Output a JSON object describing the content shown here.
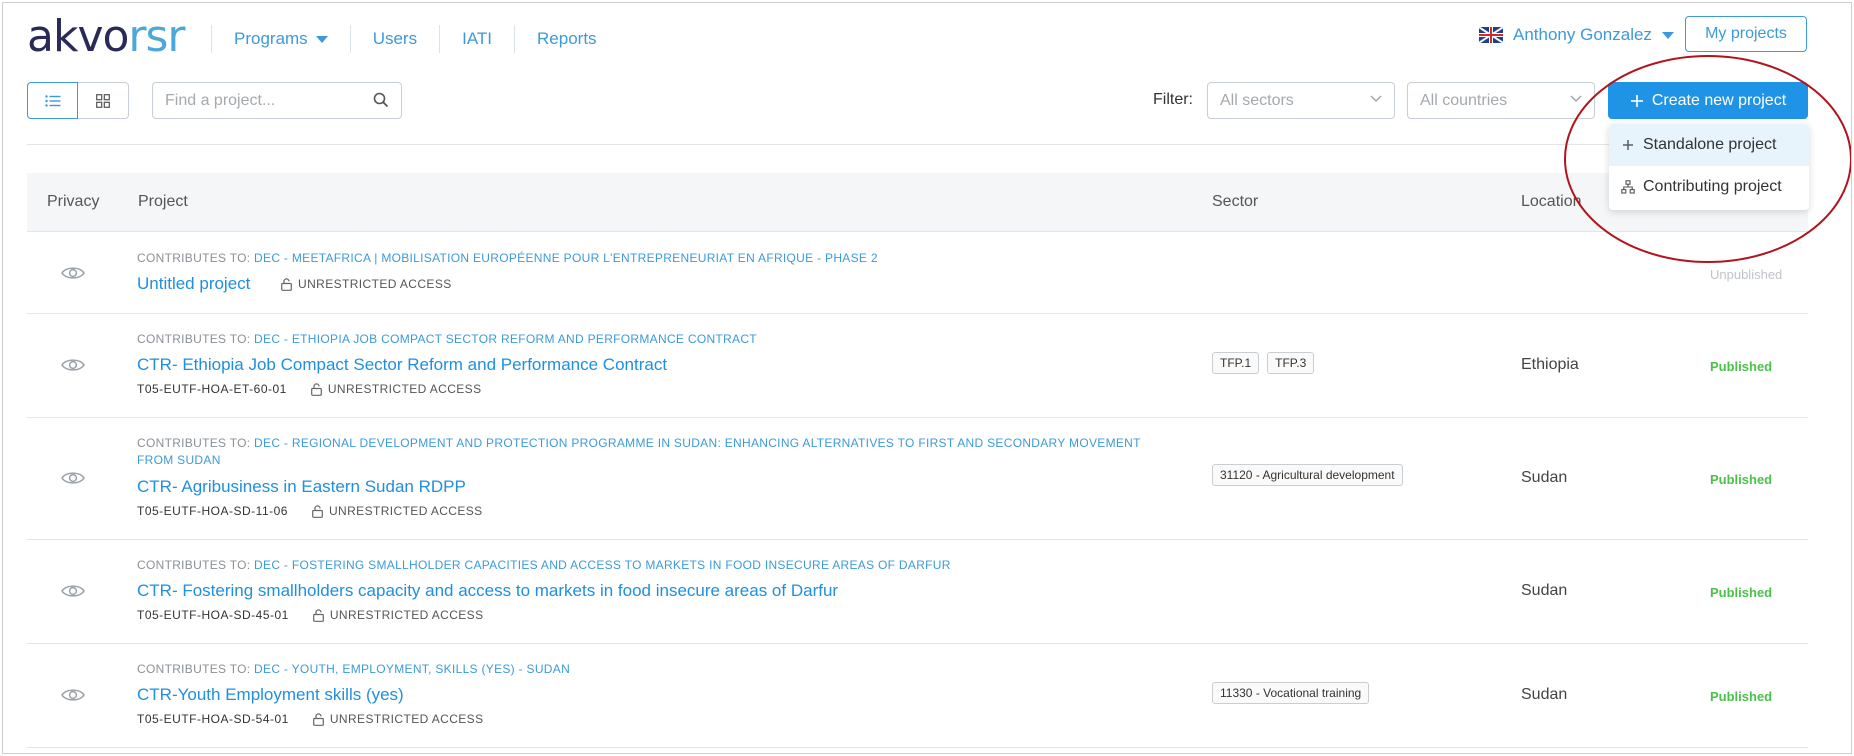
{
  "brand": {
    "part1": "akvo",
    "part2": "rsr"
  },
  "nav": [
    {
      "label": "Programs",
      "has_caret": true
    },
    {
      "label": "Users"
    },
    {
      "label": "IATI"
    },
    {
      "label": "Reports"
    }
  ],
  "user": {
    "name": "Anthony Gonzalez",
    "flag": "uk-flag-icon"
  },
  "my_projects_label": "My projects",
  "toolbar": {
    "search_placeholder": "Find a project...",
    "filter_label": "Filter:",
    "sectors_placeholder": "All sectors",
    "countries_placeholder": "All countries",
    "create_label": "Create new project"
  },
  "create_menu": {
    "items": [
      {
        "label": "Standalone project",
        "icon": "plus-icon"
      },
      {
        "label": "Contributing project",
        "icon": "hierarchy-icon"
      }
    ]
  },
  "table": {
    "headers": {
      "privacy": "Privacy",
      "project": "Project",
      "sector": "Sector",
      "location": "Location"
    },
    "rows": [
      {
        "contrib_prefix": "CONTRIBUTES TO: ",
        "contrib_link": "DEC - MEETAFRICA | MOBILISATION EUROPÉENNE POUR L'ENTREPRENEURIAT EN AFRIQUE - PHASE 2",
        "title": "Untitled project",
        "code": "",
        "access": "UNRESTRICTED ACCESS",
        "sectors": [],
        "location": "",
        "status": "Unpublished"
      },
      {
        "contrib_prefix": "CONTRIBUTES TO: ",
        "contrib_link": "DEC - ETHIOPIA JOB COMPACT SECTOR REFORM AND PERFORMANCE CONTRACT",
        "title": "CTR- Ethiopia Job Compact Sector Reform and Performance Contract",
        "code": "T05-EUTF-HOA-ET-60-01",
        "access": "UNRESTRICTED ACCESS",
        "sectors": [
          "TFP.1",
          "TFP.3"
        ],
        "location": "Ethiopia",
        "status": "Published"
      },
      {
        "contrib_prefix": "CONTRIBUTES TO: ",
        "contrib_link": "DEC - REGIONAL DEVELOPMENT AND PROTECTION PROGRAMME IN SUDAN: ENHANCING ALTERNATIVES TO FIRST AND SECONDARY MOVEMENT FROM SUDAN",
        "title": "CTR- Agribusiness in Eastern Sudan RDPP",
        "code": "T05-EUTF-HOA-SD-11-06",
        "access": "UNRESTRICTED ACCESS",
        "sectors": [
          "31120 - Agricultural development"
        ],
        "location": "Sudan",
        "status": "Published"
      },
      {
        "contrib_prefix": "CONTRIBUTES TO: ",
        "contrib_link": "DEC - FOSTERING SMALLHOLDER CAPACITIES AND ACCESS TO MARKETS IN FOOD INSECURE AREAS OF DARFUR",
        "title": "CTR- Fostering smallholders capacity and access to markets in food insecure areas of Darfur",
        "code": "T05-EUTF-HOA-SD-45-01",
        "access": "UNRESTRICTED ACCESS",
        "sectors": [],
        "location": "Sudan",
        "status": "Published"
      },
      {
        "contrib_prefix": "CONTRIBUTES TO: ",
        "contrib_link": "DEC - YOUTH, EMPLOYMENT, SKILLS (YES) - SUDAN",
        "title": "CTR-Youth Employment skills (yes)",
        "code": "T05-EUTF-HOA-SD-54-01",
        "access": "UNRESTRICTED ACCESS",
        "sectors": [
          "11330 - Vocational training"
        ],
        "location": "Sudan",
        "status": "Published"
      }
    ]
  },
  "colors": {
    "accent": "#1f93e6",
    "link": "#3d9ad8",
    "published": "#4cc14a",
    "annotation": "#b0141c",
    "brand_dark": "#2a2a59"
  }
}
